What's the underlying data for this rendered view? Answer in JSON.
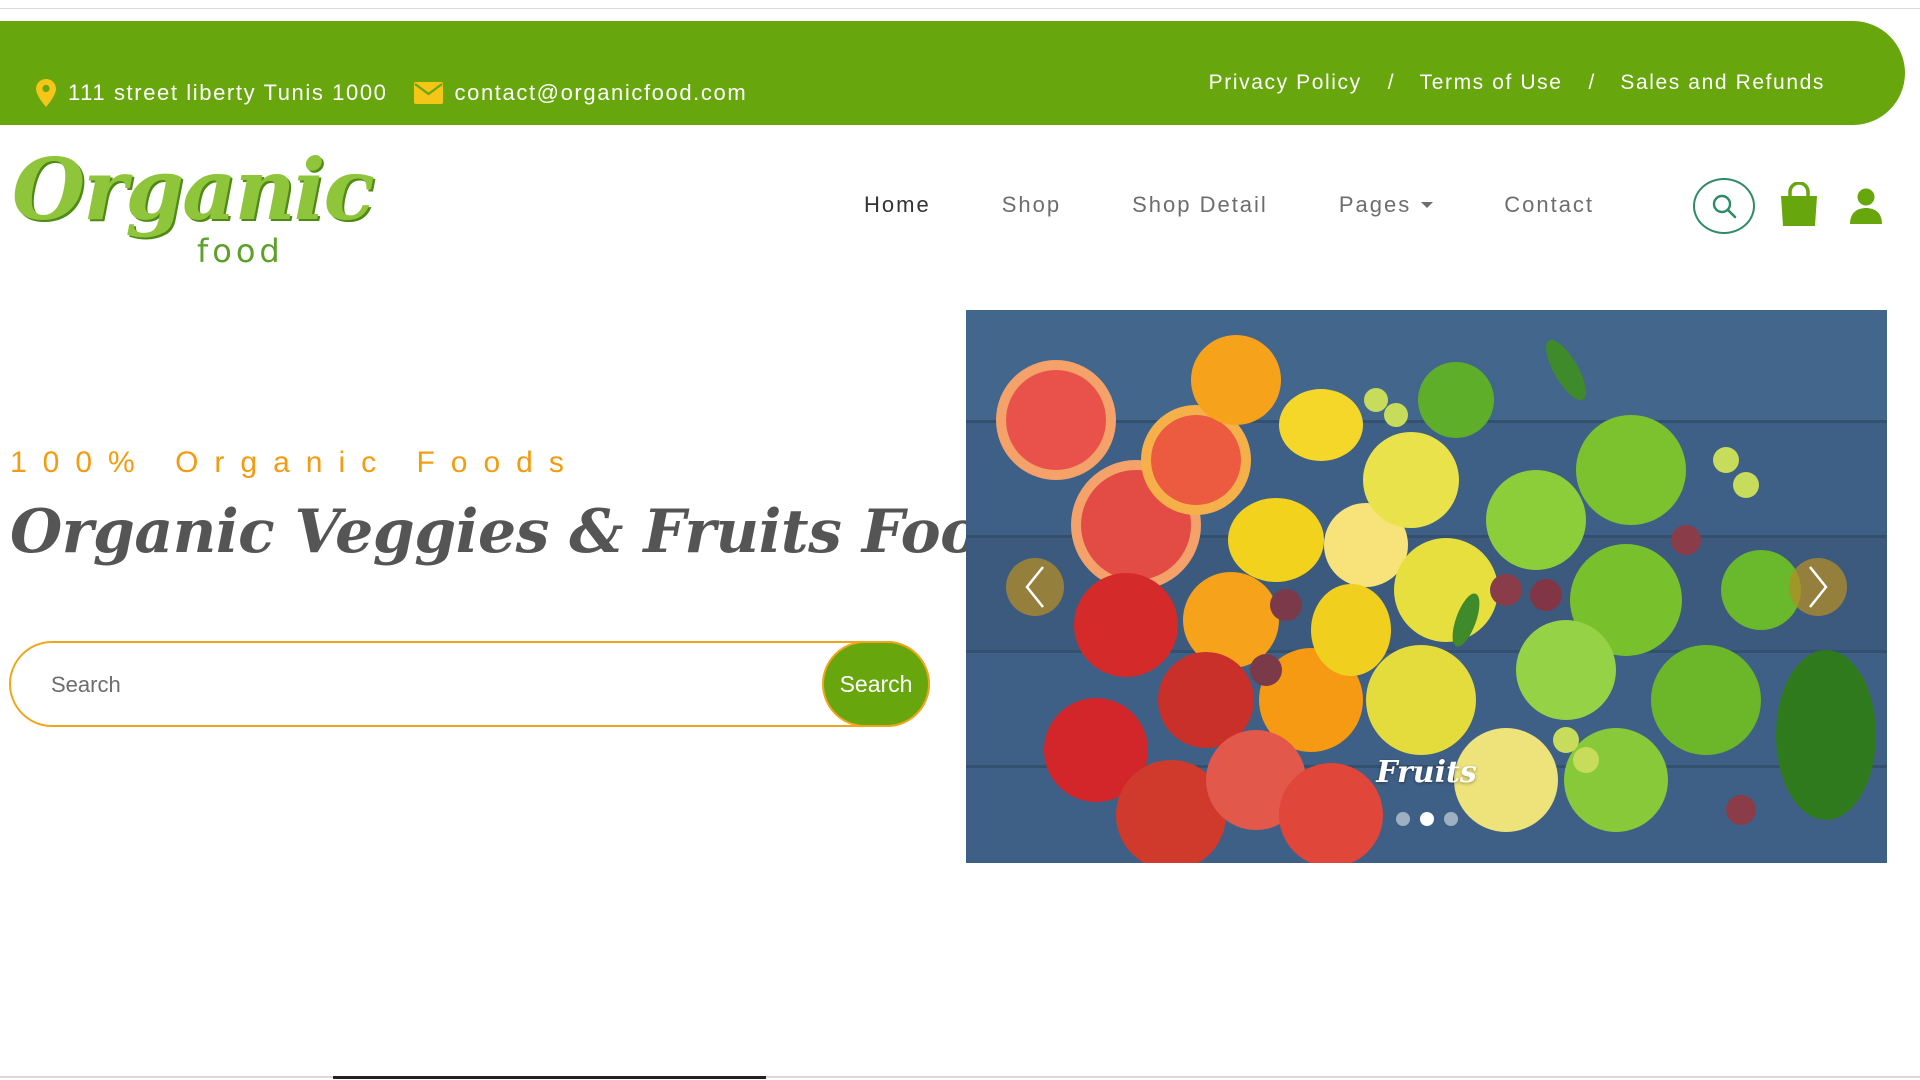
{
  "topbar": {
    "address": "111 street liberty Tunis 1000",
    "email": "contact@organicfood.com",
    "links": [
      "Privacy Policy",
      "Terms of Use",
      "Sales and Refunds"
    ],
    "separator": "/",
    "bg_color": "#68a60e",
    "icon_color": "#f5c518"
  },
  "logo": {
    "main": "Organic",
    "sub": "food"
  },
  "nav": {
    "items": [
      "Home",
      "Shop",
      "Shop Detail",
      "Pages",
      "Contact"
    ],
    "active": "Home"
  },
  "header_icons": [
    "search-icon",
    "shopping-bag-icon",
    "user-icon"
  ],
  "hero": {
    "tagline": "100% Organic Foods",
    "headline": "Organic Veggies & Fruits Foods",
    "search_placeholder": "Search",
    "search_button": "Search"
  },
  "carousel": {
    "caption": "Fruits",
    "slide_count": 3,
    "active_slide": 2
  },
  "colors": {
    "brand_green": "#68a60e",
    "accent_orange": "#f39c12",
    "search_border": "#f0a61c",
    "headline_gray": "#555555"
  }
}
